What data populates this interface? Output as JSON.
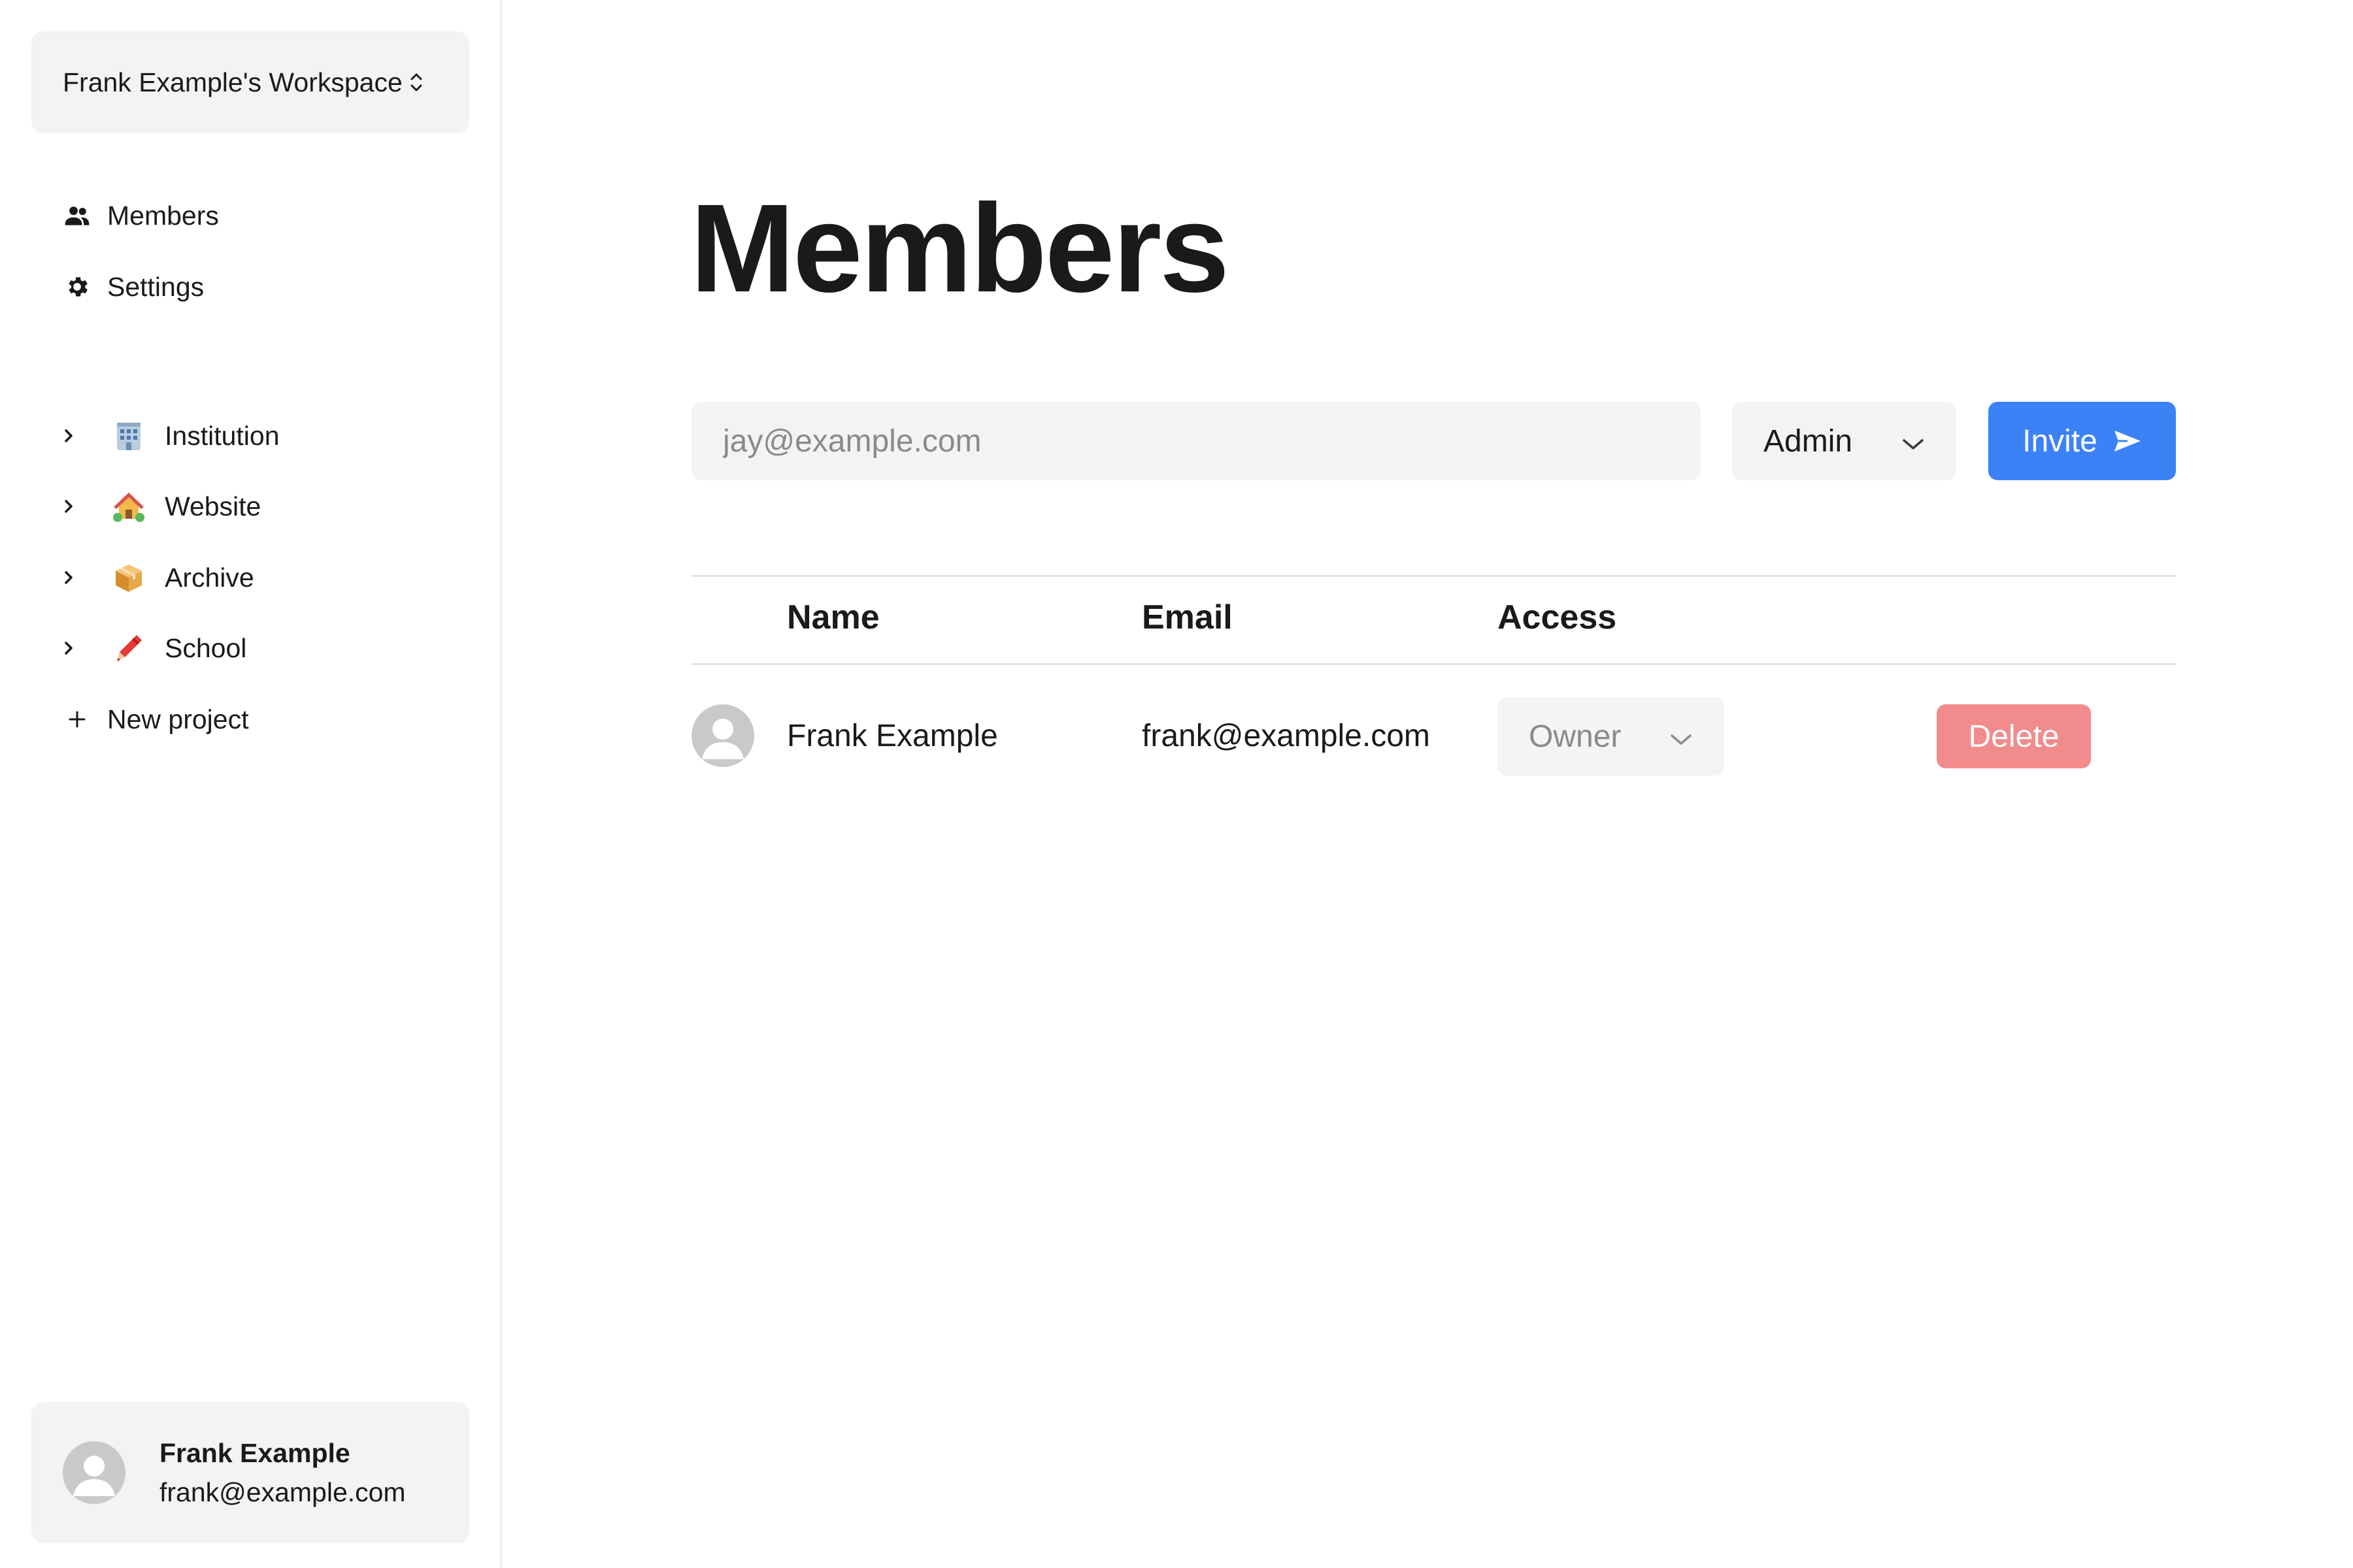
{
  "sidebar": {
    "workspace_name": "Frank Example's Workspace",
    "nav": [
      {
        "label": "Members",
        "icon": "people-icon"
      },
      {
        "label": "Settings",
        "icon": "gear-icon"
      }
    ],
    "projects": [
      {
        "label": "Institution",
        "emoji": "🏢",
        "icon": "office-building-icon"
      },
      {
        "label": "Website",
        "emoji": "🏡",
        "icon": "house-garden-icon"
      },
      {
        "label": "Archive",
        "emoji": "📦",
        "icon": "package-icon"
      },
      {
        "label": "School",
        "emoji": "🖍️",
        "icon": "crayon-icon"
      }
    ],
    "new_project_label": "New project",
    "user": {
      "name": "Frank Example",
      "email": "frank@example.com"
    }
  },
  "main": {
    "title": "Members",
    "invite": {
      "email_placeholder": "jay@example.com",
      "email_value": "",
      "role_selected": "Admin",
      "button_label": "Invite"
    },
    "table": {
      "headers": [
        "Name",
        "Email",
        "Access"
      ],
      "rows": [
        {
          "name": "Frank Example",
          "email": "frank@example.com",
          "access": "Owner",
          "action_label": "Delete"
        }
      ]
    }
  },
  "colors": {
    "accent": "#3b82f6",
    "danger": "#f28b8b",
    "panel": "#f3f3f3",
    "border": "#e3e3e3"
  }
}
